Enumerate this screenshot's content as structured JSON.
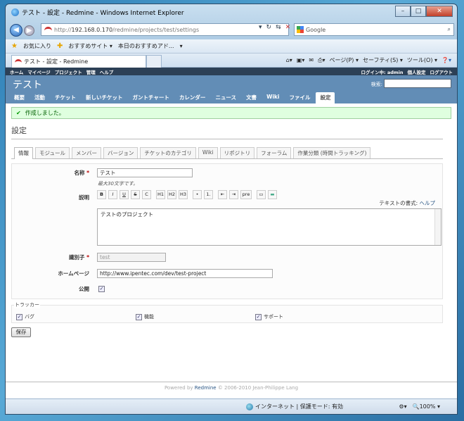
{
  "browser": {
    "window_title": "テスト - 設定 - Redmine - Windows Internet Explorer",
    "url_prefix": "http://",
    "url_host": "192.168.0.170",
    "url_path": "/redmine/projects/test/settings",
    "search_engine": "Google",
    "favorites_label": "お気に入り",
    "fav_items": [
      "おすすめサイト ▾",
      "本日のおすすめアド..."
    ],
    "tab_title": "テスト - 設定 - Redmine",
    "cmd_items": [
      "ページ(P) ▾",
      "セーフティ(S) ▾",
      "ツール(O) ▾"
    ],
    "status_zone": "インターネット | 保護モード: 有効",
    "zoom": "100%"
  },
  "redmine": {
    "top_menu": [
      "ホーム",
      "マイページ",
      "プロジェクト",
      "管理",
      "ヘルプ"
    ],
    "logged_in_prefix": "ログイン中:",
    "logged_in_user": "admin",
    "account_links": [
      "個人設定",
      "ログアウト"
    ],
    "project_title": "テスト",
    "search_label": "検索:",
    "main_menu": [
      "概要",
      "活動",
      "チケット",
      "新しいチケット",
      "ガントチャート",
      "カレンダー",
      "ニュース",
      "文書",
      "Wiki",
      "ファイル",
      "設定"
    ],
    "flash_notice": "作成しました。",
    "page_heading": "設定",
    "settings_tabs": [
      "情報",
      "モジュール",
      "メンバー",
      "バージョン",
      "チケットのカテゴリ",
      "Wiki",
      "リポジトリ",
      "フォーラム",
      "作業分類 (時間トラッキング)"
    ],
    "form": {
      "name_label": "名称",
      "name_value": "テスト",
      "name_note": "最大30文字です。",
      "desc_label": "説明",
      "toolbar": [
        "B",
        "I",
        "U",
        "S",
        "C",
        "H1",
        "H2",
        "H3",
        "•",
        "1.",
        "⇤",
        "⇥",
        "pre",
        "▭",
        "▬"
      ],
      "text_format_label": "テキストの書式:",
      "help_link": "ヘルプ",
      "desc_value": "テストのプロジェクト",
      "identifier_label": "識別子",
      "identifier_value": "test",
      "homepage_label": "ホームページ",
      "homepage_value": "http://www.ipentec.com/dev/test-project",
      "public_label": "公開"
    },
    "trackers_legend": "トラッカー",
    "trackers": [
      "バグ",
      "機能",
      "サポート"
    ],
    "save_button": "保存",
    "footer_powered": "Powered by",
    "footer_link": "Redmine",
    "footer_copy": "© 2006-2010 Jean-Philippe Lang"
  }
}
